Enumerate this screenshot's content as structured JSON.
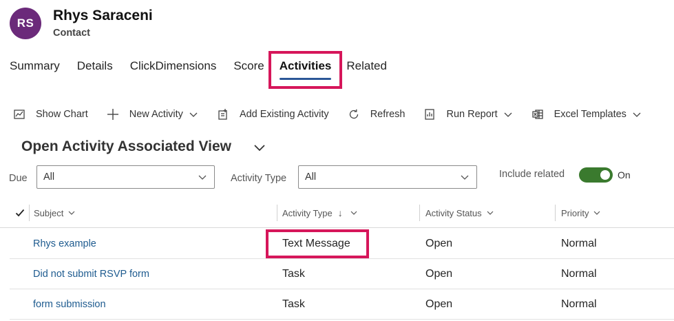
{
  "header": {
    "avatar_initials": "RS",
    "avatar_color": "#6b2a7a",
    "record_name": "Rhys Saraceni",
    "record_type": "Contact"
  },
  "tabs": [
    {
      "label": "Summary",
      "active": false
    },
    {
      "label": "Details",
      "active": false
    },
    {
      "label": "ClickDimensions",
      "active": false
    },
    {
      "label": "Score",
      "active": false
    },
    {
      "label": "Activities",
      "active": true
    },
    {
      "label": "Related",
      "active": false
    }
  ],
  "commands": [
    {
      "label": "Show Chart",
      "icon": "chart-icon"
    },
    {
      "label": "New Activity",
      "icon": "plus-icon"
    },
    {
      "label": "Add Existing Activity",
      "icon": "add-existing-icon"
    },
    {
      "label": "Refresh",
      "icon": "refresh-icon"
    },
    {
      "label": "Run Report",
      "icon": "report-icon"
    },
    {
      "label": "Excel Templates",
      "icon": "excel-icon"
    }
  ],
  "view": {
    "title": "Open Activity Associated View"
  },
  "filters": {
    "due_label": "Due",
    "due_value": "All",
    "type_label": "Activity Type",
    "type_value": "All",
    "include_related_label": "Include related",
    "include_related_state": "On"
  },
  "grid": {
    "columns": [
      "Subject",
      "Activity Type",
      "Activity Status",
      "Priority"
    ],
    "sort_indicator": "↓",
    "rows": [
      {
        "subject": "Rhys example",
        "type": "Text Message",
        "status": "Open",
        "priority": "Normal"
      },
      {
        "subject": "Did not submit RSVP form",
        "type": "Task",
        "status": "Open",
        "priority": "Normal"
      },
      {
        "subject": "form submission",
        "type": "Task",
        "status": "Open",
        "priority": "Normal"
      }
    ]
  },
  "colors": {
    "highlight": "#d6165a",
    "tab_underline": "#2b5797",
    "toggle_on": "#3a7a2e",
    "link": "#1e5b8f"
  }
}
